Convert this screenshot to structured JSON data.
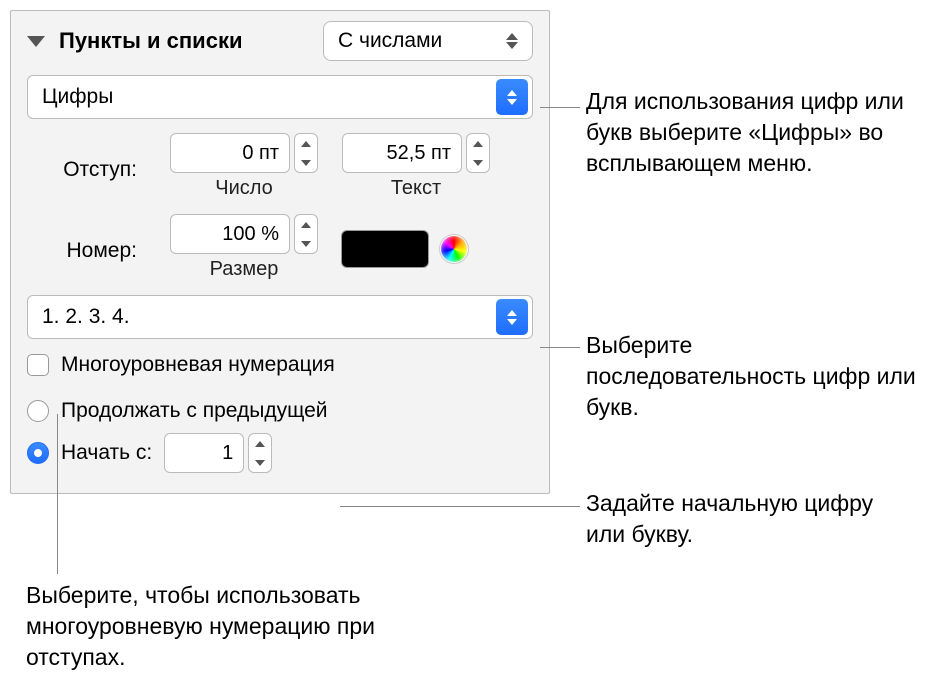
{
  "header": {
    "title": "Пункты и списки",
    "type_select": "С числами"
  },
  "format_select": "Цифры",
  "indent": {
    "label": "Отступ:",
    "number_value": "0 пт",
    "number_caption": "Число",
    "text_value": "52,5 пт",
    "text_caption": "Текст"
  },
  "number": {
    "label": "Номер:",
    "size_value": "100 %",
    "size_caption": "Размер"
  },
  "seq_select": "1. 2. 3. 4.",
  "tiered_label": "Многоуровневая нумерация",
  "continue_label": "Продолжать с предыдущей",
  "start_label": "Начать с:",
  "start_value": "1",
  "callouts": {
    "c1": "Для использования цифр или букв выберите «Цифры» во всплывающем меню.",
    "c2": "Выберите последовательность цифр или букв.",
    "c3": "Задайте начальную цифру или букву.",
    "c4": "Выберите, чтобы использовать многоуровневую нумерацию при отступах."
  }
}
